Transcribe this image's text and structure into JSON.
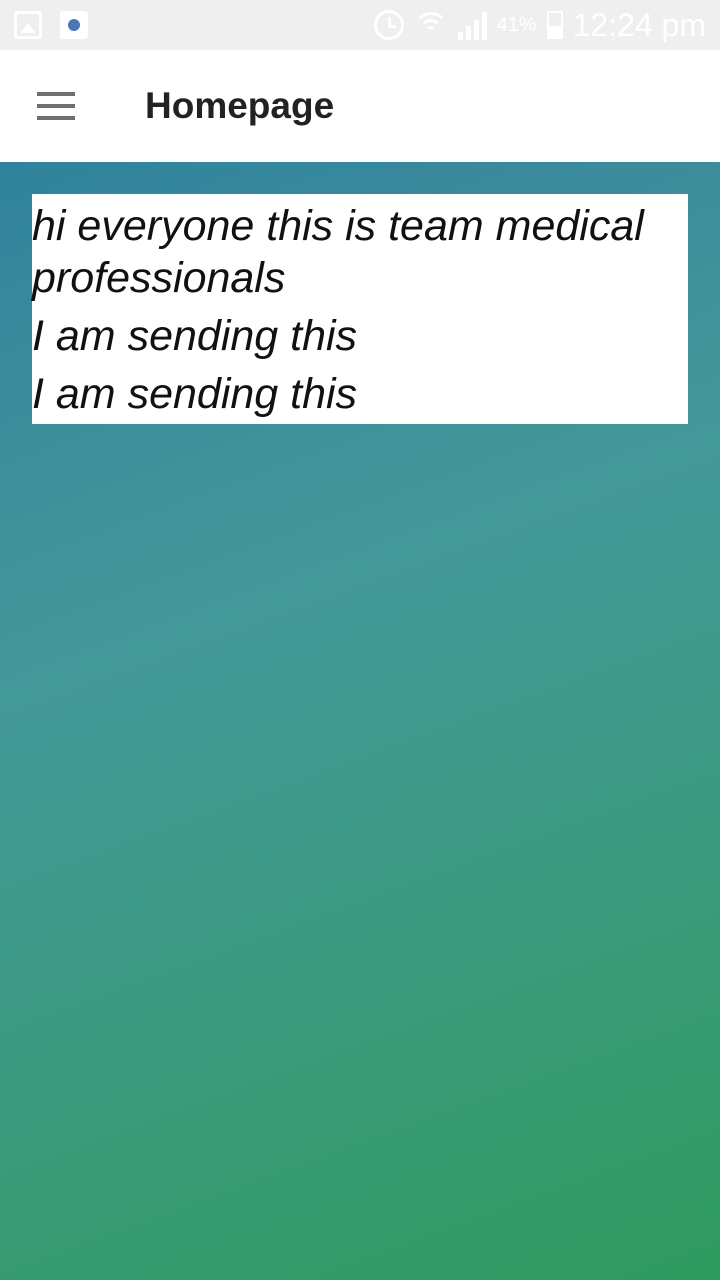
{
  "status_bar": {
    "notification_icons": [
      "gallery-icon",
      "app-icon"
    ],
    "alarm_icon": "alarm-icon",
    "wifi_icon": "wifi-icon",
    "signal_icon": "signal-icon",
    "battery_percent": "41%",
    "time": "12:24 pm"
  },
  "app_bar": {
    "menu_icon": "hamburger-menu-icon",
    "title": "Homepage"
  },
  "messages": [
    "hi everyone this is team medical professionals",
    "I am sending this",
    "I am sending this"
  ],
  "colors": {
    "gradient_start": "#2a7d9f",
    "gradient_end": "#2e9a5e",
    "status_bar_bg": "#efefef",
    "app_bar_bg": "#ffffff"
  }
}
